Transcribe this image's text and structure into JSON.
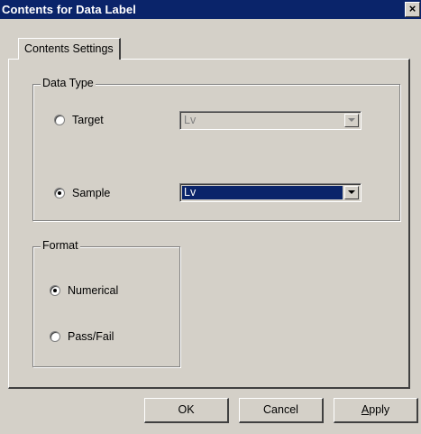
{
  "window": {
    "title": "Contents for Data Label",
    "close_glyph": "×"
  },
  "tabs": [
    {
      "label": "Contents Settings",
      "selected": true
    }
  ],
  "data_type": {
    "label": "Data Type",
    "options": [
      {
        "label": "Target",
        "checked": false,
        "combo_value": "Lv",
        "combo_enabled": false
      },
      {
        "label": "Sample",
        "checked": true,
        "combo_value": "Lv",
        "combo_enabled": true
      }
    ]
  },
  "format": {
    "label": "Format",
    "options": [
      {
        "label": "Numerical",
        "checked": true
      },
      {
        "label": "Pass/Fail",
        "checked": false
      }
    ]
  },
  "buttons": {
    "ok": "OK",
    "cancel": "Cancel",
    "apply_first": "A",
    "apply_rest": "pply"
  },
  "colors": {
    "titlebar": "#0a246a",
    "dialog_bg": "#d4d0c8",
    "selection": "#0a246a"
  }
}
